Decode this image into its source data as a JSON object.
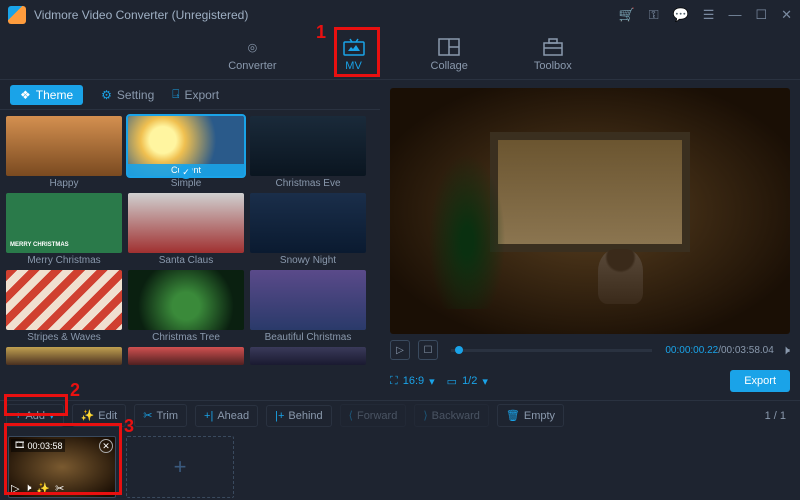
{
  "app": {
    "title": "Vidmore Video Converter (Unregistered)"
  },
  "nav": {
    "converter": "Converter",
    "mv": "MV",
    "collage": "Collage",
    "toolbox": "Toolbox"
  },
  "subtabs": {
    "theme": "Theme",
    "setting": "Setting",
    "export": "Export"
  },
  "themes": [
    {
      "label": "Happy"
    },
    {
      "label": "Simple",
      "current": "Current"
    },
    {
      "label": "Christmas Eve"
    },
    {
      "label": "Merry Christmas"
    },
    {
      "label": "Santa Claus"
    },
    {
      "label": "Snowy Night"
    },
    {
      "label": "Stripes & Waves"
    },
    {
      "label": "Christmas Tree"
    },
    {
      "label": "Beautiful Christmas"
    }
  ],
  "player": {
    "time_current": "00:00:00.22",
    "time_total": "/00:03:58.04",
    "aspect": "16:9",
    "page": "1/2"
  },
  "export_button": "Export",
  "toolbar": {
    "add": "Add",
    "edit": "Edit",
    "trim": "Trim",
    "ahead": "Ahead",
    "behind": "Behind",
    "forward": "Forward",
    "backward": "Backward",
    "empty": "Empty",
    "page": "1 / 1"
  },
  "clip": {
    "duration": "00:03:58"
  },
  "callouts": {
    "c1": "1",
    "c2": "2",
    "c3": "3"
  }
}
